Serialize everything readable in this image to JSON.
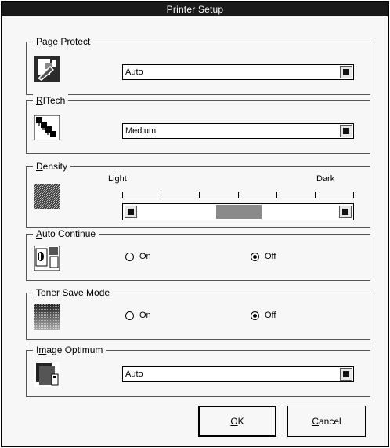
{
  "window": {
    "title": "Printer Setup"
  },
  "page_protect": {
    "title_pre": "",
    "title_key": "P",
    "title_post": "age Protect",
    "value": "Auto",
    "icon": "page-protect-icon"
  },
  "ritech": {
    "title_pre": "",
    "title_key": "R",
    "title_post": "ITech",
    "value": "Medium",
    "icon": "ritech-icon"
  },
  "density": {
    "title_pre": "",
    "title_key": "D",
    "title_post": "ensity",
    "low_label": "Light",
    "high_label": "Dark",
    "level": 0.5,
    "ticks": 7,
    "icon": "density-icon"
  },
  "auto_continue": {
    "title_pre": "",
    "title_key": "A",
    "title_post": "uto Continue",
    "on_label": "On",
    "off_label": "Off",
    "selected": "off",
    "icon": "auto-continue-icon"
  },
  "toner_save": {
    "title_pre": "",
    "title_key": "T",
    "title_post": "oner Save Mode",
    "on_label": "On",
    "off_label": "Off",
    "selected": "off",
    "icon": "toner-save-icon"
  },
  "image_optimum": {
    "title_pre": "I",
    "title_key": "m",
    "title_post": "age Optimum",
    "value": "Auto",
    "icon": "image-optimum-icon"
  },
  "buttons": {
    "ok_key": "O",
    "ok_post": "K",
    "cancel_pre": "",
    "cancel_key": "C",
    "cancel_post": "ancel"
  }
}
